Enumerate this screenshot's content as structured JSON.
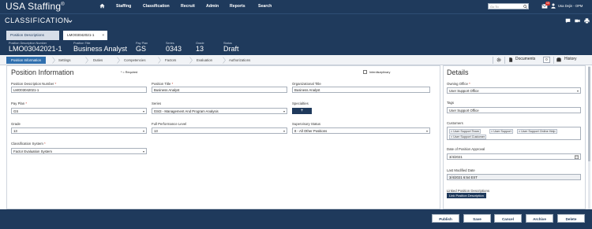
{
  "app": {
    "logo_text": "USA Staffing",
    "logo_mark": "®",
    "module_title": "CLASSIFICATION"
  },
  "nav": {
    "items": [
      "Staffing",
      "Classification",
      "Recruit",
      "Admin",
      "Reports",
      "Search"
    ],
    "goto_placeholder": "Go To",
    "mail_badge": "10",
    "user_name": "Usa Dejin - OPM"
  },
  "tabs": {
    "list_label": "Position Descriptions",
    "active_label": "LMO03042021-1",
    "close_glyph": "×"
  },
  "record": {
    "fields": [
      {
        "label": "Position Description Number",
        "value": "LMO03042021-1"
      },
      {
        "label": "Position Title",
        "value": "Business Analyst"
      },
      {
        "label": "Pay Plan",
        "value": "GS"
      },
      {
        "label": "Series",
        "value": "0343"
      },
      {
        "label": "Grade",
        "value": "13"
      },
      {
        "label": "Status",
        "value": "Draft"
      }
    ]
  },
  "steps": [
    "Position Information",
    "Settings",
    "Duties",
    "Competencies",
    "Factors",
    "Evaluation",
    "Authorizations"
  ],
  "tools": {
    "documents_label": "Documents",
    "documents_count": "0",
    "history_label": "History"
  },
  "main": {
    "title": "Position Information",
    "required_note": "* = Required",
    "interdisciplinary_label": "Interdisciplinary",
    "pd_number": {
      "label": "Position Description Number",
      "value": "LMO03042021-1"
    },
    "position_title": {
      "label": "Position Title",
      "value": "Business Analyst"
    },
    "org_title": {
      "label": "Organizational Title",
      "value": "Business Analyst"
    },
    "pay_plan": {
      "label": "Pay Plan",
      "value": "GS"
    },
    "series": {
      "label": "Series",
      "value": "0343 - Management And Program Analysis"
    },
    "specialties": {
      "label": "Specialties",
      "button": "+"
    },
    "grade": {
      "label": "Grade",
      "value": "13"
    },
    "full_performance": {
      "label": "Full Performance Level",
      "value": "13"
    },
    "supervisory": {
      "label": "Supervisory Status",
      "value": "8 - All Other Positions"
    },
    "classification_system": {
      "label": "Classification System",
      "value": "Factor Evaluation System"
    }
  },
  "details": {
    "title": "Details",
    "owning_office": {
      "label": "Owning Office",
      "value": "User Support Office"
    },
    "tags": {
      "label": "Tags",
      "chips": [
        "User Support Office"
      ]
    },
    "customers": {
      "label": "Customers",
      "chips": [
        "User Support Team",
        "User Support",
        "User Support Online Help",
        "User Support Customer"
      ]
    },
    "approval_date": {
      "label": "Date of Position Approval",
      "value": "3/4/2021"
    },
    "last_modified": {
      "label": "Last Modified Date",
      "value": "3/4/2021 6:54 EST"
    },
    "linked": {
      "label": "Linked Position Descriptions",
      "button": "Link Position Description"
    }
  },
  "actions": [
    "Publish",
    "Save",
    "Cancel",
    "Archive",
    "Delete"
  ],
  "colors": {
    "navy": "#1f3a5c",
    "active_step": "#2f6fae",
    "required": "#c0392b"
  }
}
